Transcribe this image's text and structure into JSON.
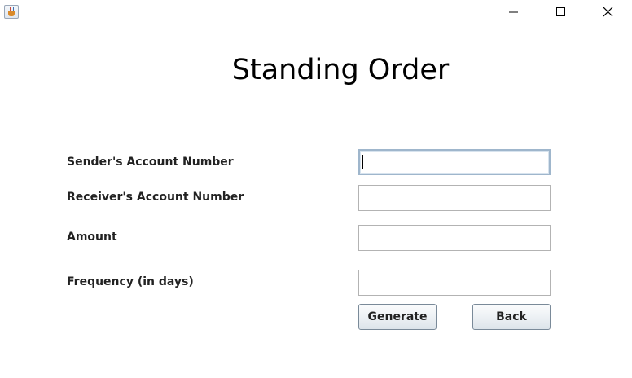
{
  "window": {
    "icon": "java-cup-icon",
    "controls": {
      "minimize_icon": "minimize-icon",
      "maximize_icon": "maximize-icon",
      "close_icon": "close-icon"
    }
  },
  "form": {
    "title": "Standing Order",
    "fields": [
      {
        "label": "Sender's Account Number",
        "value": "",
        "focused": true
      },
      {
        "label": "Receiver's Account Number",
        "value": ""
      },
      {
        "label": "Amount",
        "value": ""
      },
      {
        "label": "Frequency (in days)",
        "value": ""
      }
    ],
    "buttons": {
      "generate_label": "Generate",
      "back_label": "Back"
    }
  },
  "colors": {
    "background": "#ffffff",
    "focus_border": "#9fb6cc",
    "field_border": "#b3b3b3",
    "button_border": "#7a8a99"
  }
}
